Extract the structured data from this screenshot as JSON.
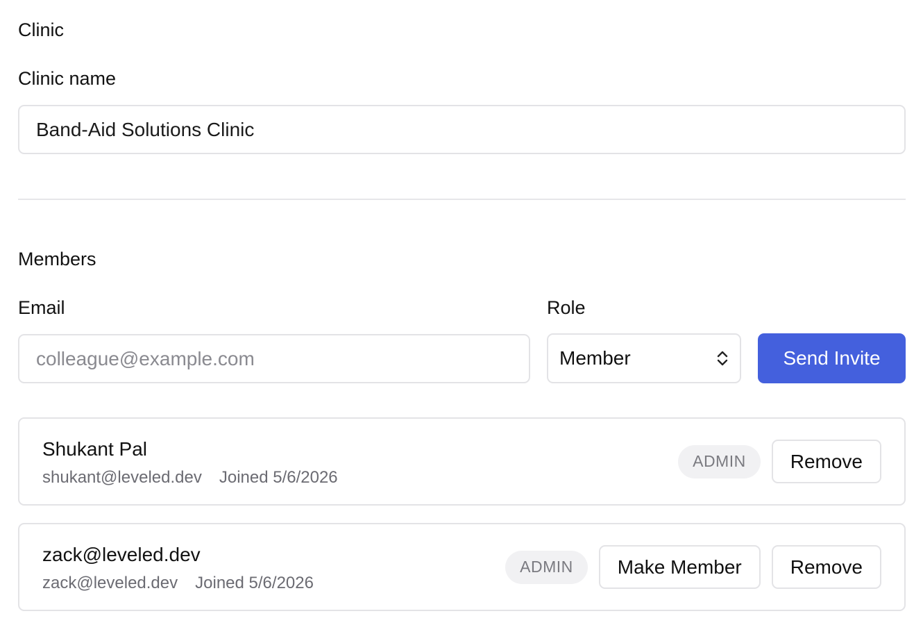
{
  "clinic": {
    "section_title": "Clinic",
    "name_label": "Clinic name",
    "name_value": "Band-Aid Solutions Clinic"
  },
  "members": {
    "section_title": "Members",
    "invite": {
      "email_label": "Email",
      "email_placeholder": "colleague@example.com",
      "role_label": "Role",
      "role_value": "Member",
      "role_icon": "chevron-up-down-icon",
      "send_label": "Send Invite",
      "accent_color": "#4460dd"
    },
    "list": [
      {
        "name": "Shukant Pal",
        "email": "shukant@leveled.dev",
        "joined": "Joined 5/6/2026",
        "role_badge": "ADMIN",
        "remove_label": "Remove"
      },
      {
        "name": "zack@leveled.dev",
        "email": "zack@leveled.dev",
        "joined": "Joined 5/6/2026",
        "role_badge": "ADMIN",
        "make_member_label": "Make Member",
        "remove_label": "Remove"
      }
    ]
  }
}
